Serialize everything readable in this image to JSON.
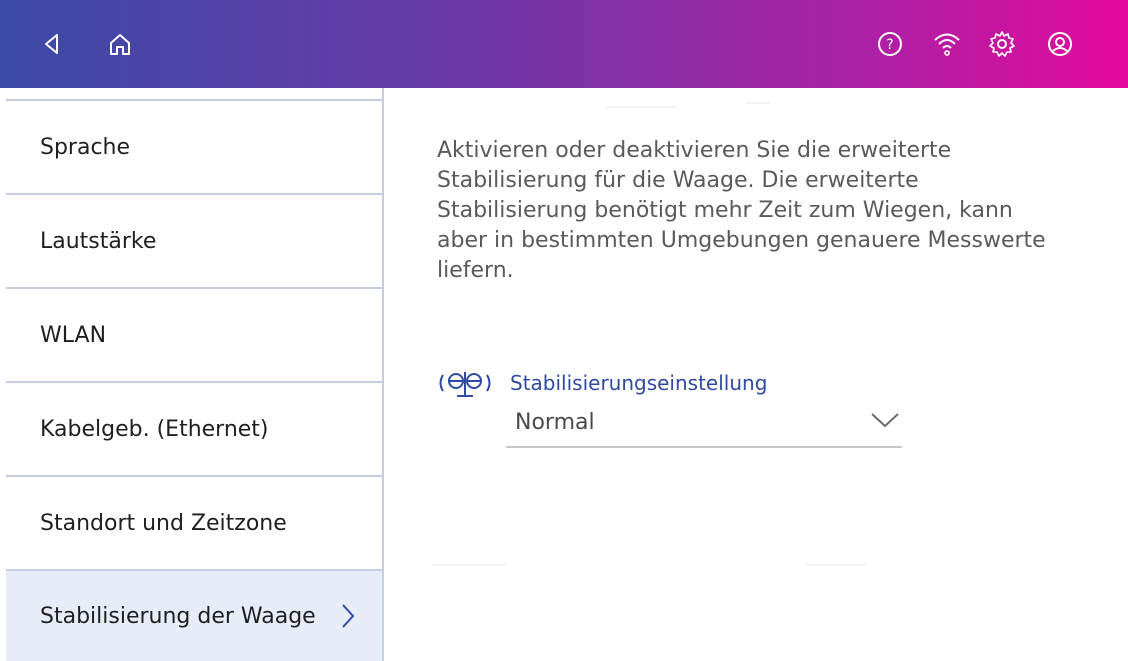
{
  "topbar": {
    "icons": [
      "back-icon",
      "home-icon",
      "help-icon",
      "wifi-icon",
      "settings-icon",
      "account-icon"
    ]
  },
  "sidebar": {
    "items": [
      {
        "label": "Sprache"
      },
      {
        "label": "Lautstärke"
      },
      {
        "label": "WLAN"
      },
      {
        "label": "Kabelgeb. (Ethernet)"
      },
      {
        "label": "Standort und Zeitzone"
      },
      {
        "label": "Stabilisierung der Waage"
      }
    ],
    "active_index": 5
  },
  "main": {
    "description": "Aktivieren oder deaktivieren Sie die erweiterte Stabilisierung für die Waage. Die erweiterte Stabilisierung benötigt mehr Zeit zum Wiegen, kann aber in bestimmten Umgebungen genauere Messwerte liefern.",
    "field_label": "Stabilisierungseinstellung",
    "field_icon": "scale-icon",
    "selected_value": "Normal"
  },
  "colors": {
    "accent": "#2f4aa0",
    "gradient_start": "#3b4aa6",
    "gradient_end": "#e4099c",
    "active_row": "#e8ecf8"
  }
}
